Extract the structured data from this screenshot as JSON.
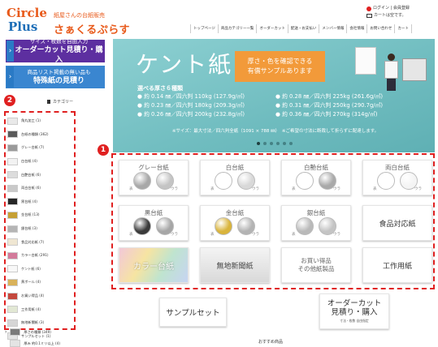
{
  "header": {
    "logo_circle": "Circle",
    "logo_plus": "Plus",
    "logo_sub": "紙屋さんの台紙販売",
    "logo_name": "さぁくるぷらす",
    "account_line1": "ログイン | 会員登録",
    "account_line2": "カートは空です。",
    "nav": [
      "トップページ",
      "商品カテゴリー一覧",
      "オーダーカット",
      "配送・お支払い",
      "メンバー情報",
      "会社情報",
      "お問い合わせ",
      "カート"
    ]
  },
  "side_banners": [
    {
      "line1": "サイズ・枚数を自由入力",
      "line2": "オーダーカット見積り・購入"
    },
    {
      "line1": "商品リスト掲載の無い品も",
      "line2": "特殊紙の見積り"
    }
  ],
  "category": {
    "heading": "カテゴリー",
    "items": [
      {
        "label": "角丸加工 (1)",
        "color": "#e9e9e9"
      },
      {
        "label": "台紙の種類 (362)",
        "color": "#5a5a5a"
      },
      {
        "label": "グレー台紙 (7)",
        "color": "#9a9a9a"
      },
      {
        "label": "白台紙 (4)",
        "color": "#f2f2f2"
      },
      {
        "label": "白艶台紙 (6)",
        "color": "#dcdcdc"
      },
      {
        "label": "両白台紙 (6)",
        "color": "#c9c9c9"
      },
      {
        "label": "黒台紙 (4)",
        "color": "#262626"
      },
      {
        "label": "金台紙 (13)",
        "color": "#c6a034"
      },
      {
        "label": "銀台紙 (3)",
        "color": "#b5b5b5"
      },
      {
        "label": "食品対応紙 (7)",
        "color": "#efe6d2"
      },
      {
        "label": "カラー台紙 (291)",
        "color": "#d37a9a"
      },
      {
        "label": "ケント紙 (6)",
        "color": "#f8f8f8"
      },
      {
        "label": "黄ボール (4)",
        "color": "#d9b25a"
      },
      {
        "label": "お買い得品 (4)",
        "color": "#c4483d"
      },
      {
        "label": "工作用紙 (4)",
        "color": "#e2e8d4"
      },
      {
        "label": "無地新聞紙 (3)",
        "color": "#d6d6d6"
      },
      {
        "label": "サンプルセット (1)",
        "color": "#e5e5e5"
      }
    ],
    "below": [
      "厚さの種類 (349)",
      "厚み 約0.1ミリ以上 (4)"
    ]
  },
  "badges": {
    "one": "1",
    "two": "2"
  },
  "hero": {
    "title": "ケント紙",
    "box_line1": "厚さ・色を確認できる",
    "box_line2": "有償サンプルあります",
    "subtitle": "選べる厚さ６種類",
    "thickness": [
      [
        "● 約 0.14 ㎜／四六判 110kg (127.9g/㎡)",
        "● 約 0.28 ㎜／四六判 225kg (261.6g/㎡)"
      ],
      [
        "● 約 0.23 ㎜／四六判 180kg (209.3g/㎡)",
        "● 約 0.31 ㎜／四六判 250kg (290.7g/㎡)"
      ],
      [
        "● 約 0.26 ㎜／四六判 200kg (232.8g/㎡)",
        "● 約 0.36 ㎜／四六判 270kg (314g/㎡)"
      ]
    ],
    "note": "※サイズ：最大寸法／四六判全紙（1091 × 788 ㎜）　※ご希望の寸法に断裁して折らずに配達します。",
    "dots": 6,
    "active_dot": 0
  },
  "products": {
    "side_front": "表",
    "side_back": "ウラ",
    "tiles": [
      {
        "label": "グレー台紙",
        "front": "#a8a8a8",
        "back": "#c4c4c4"
      },
      {
        "label": "白台紙",
        "front": "#ffffff",
        "back": "#d8d8d8"
      },
      {
        "label": "白艶台紙",
        "front": "#ffffff",
        "back": "#a9a9a9"
      },
      {
        "label": "両白台紙",
        "front": "#ffffff",
        "back": "#f4f4f4"
      },
      {
        "label": "黒台紙",
        "front": "#3a3a3a",
        "back": "#a6a6a6"
      },
      {
        "label": "金台紙",
        "front": "#d9b43b",
        "back": "#b3b3b3"
      },
      {
        "label": "銀台紙",
        "front": "#b9b9b9",
        "back": "#c4c4c4"
      }
    ],
    "food": "食品対応紙",
    "color": "カラー台紙",
    "newspaper": "無地新聞紙",
    "bargain_line1": "お買い得品",
    "bargain_line2": "その他紙製品",
    "craft": "工作用紙"
  },
  "buttons": {
    "sample": "サンプルセット",
    "order_line1": "オーダーカット",
    "order_line2": "見積り・購入",
    "order_line3": "寸法・枚数 自由指定"
  },
  "recommend": "おすすめ商品"
}
